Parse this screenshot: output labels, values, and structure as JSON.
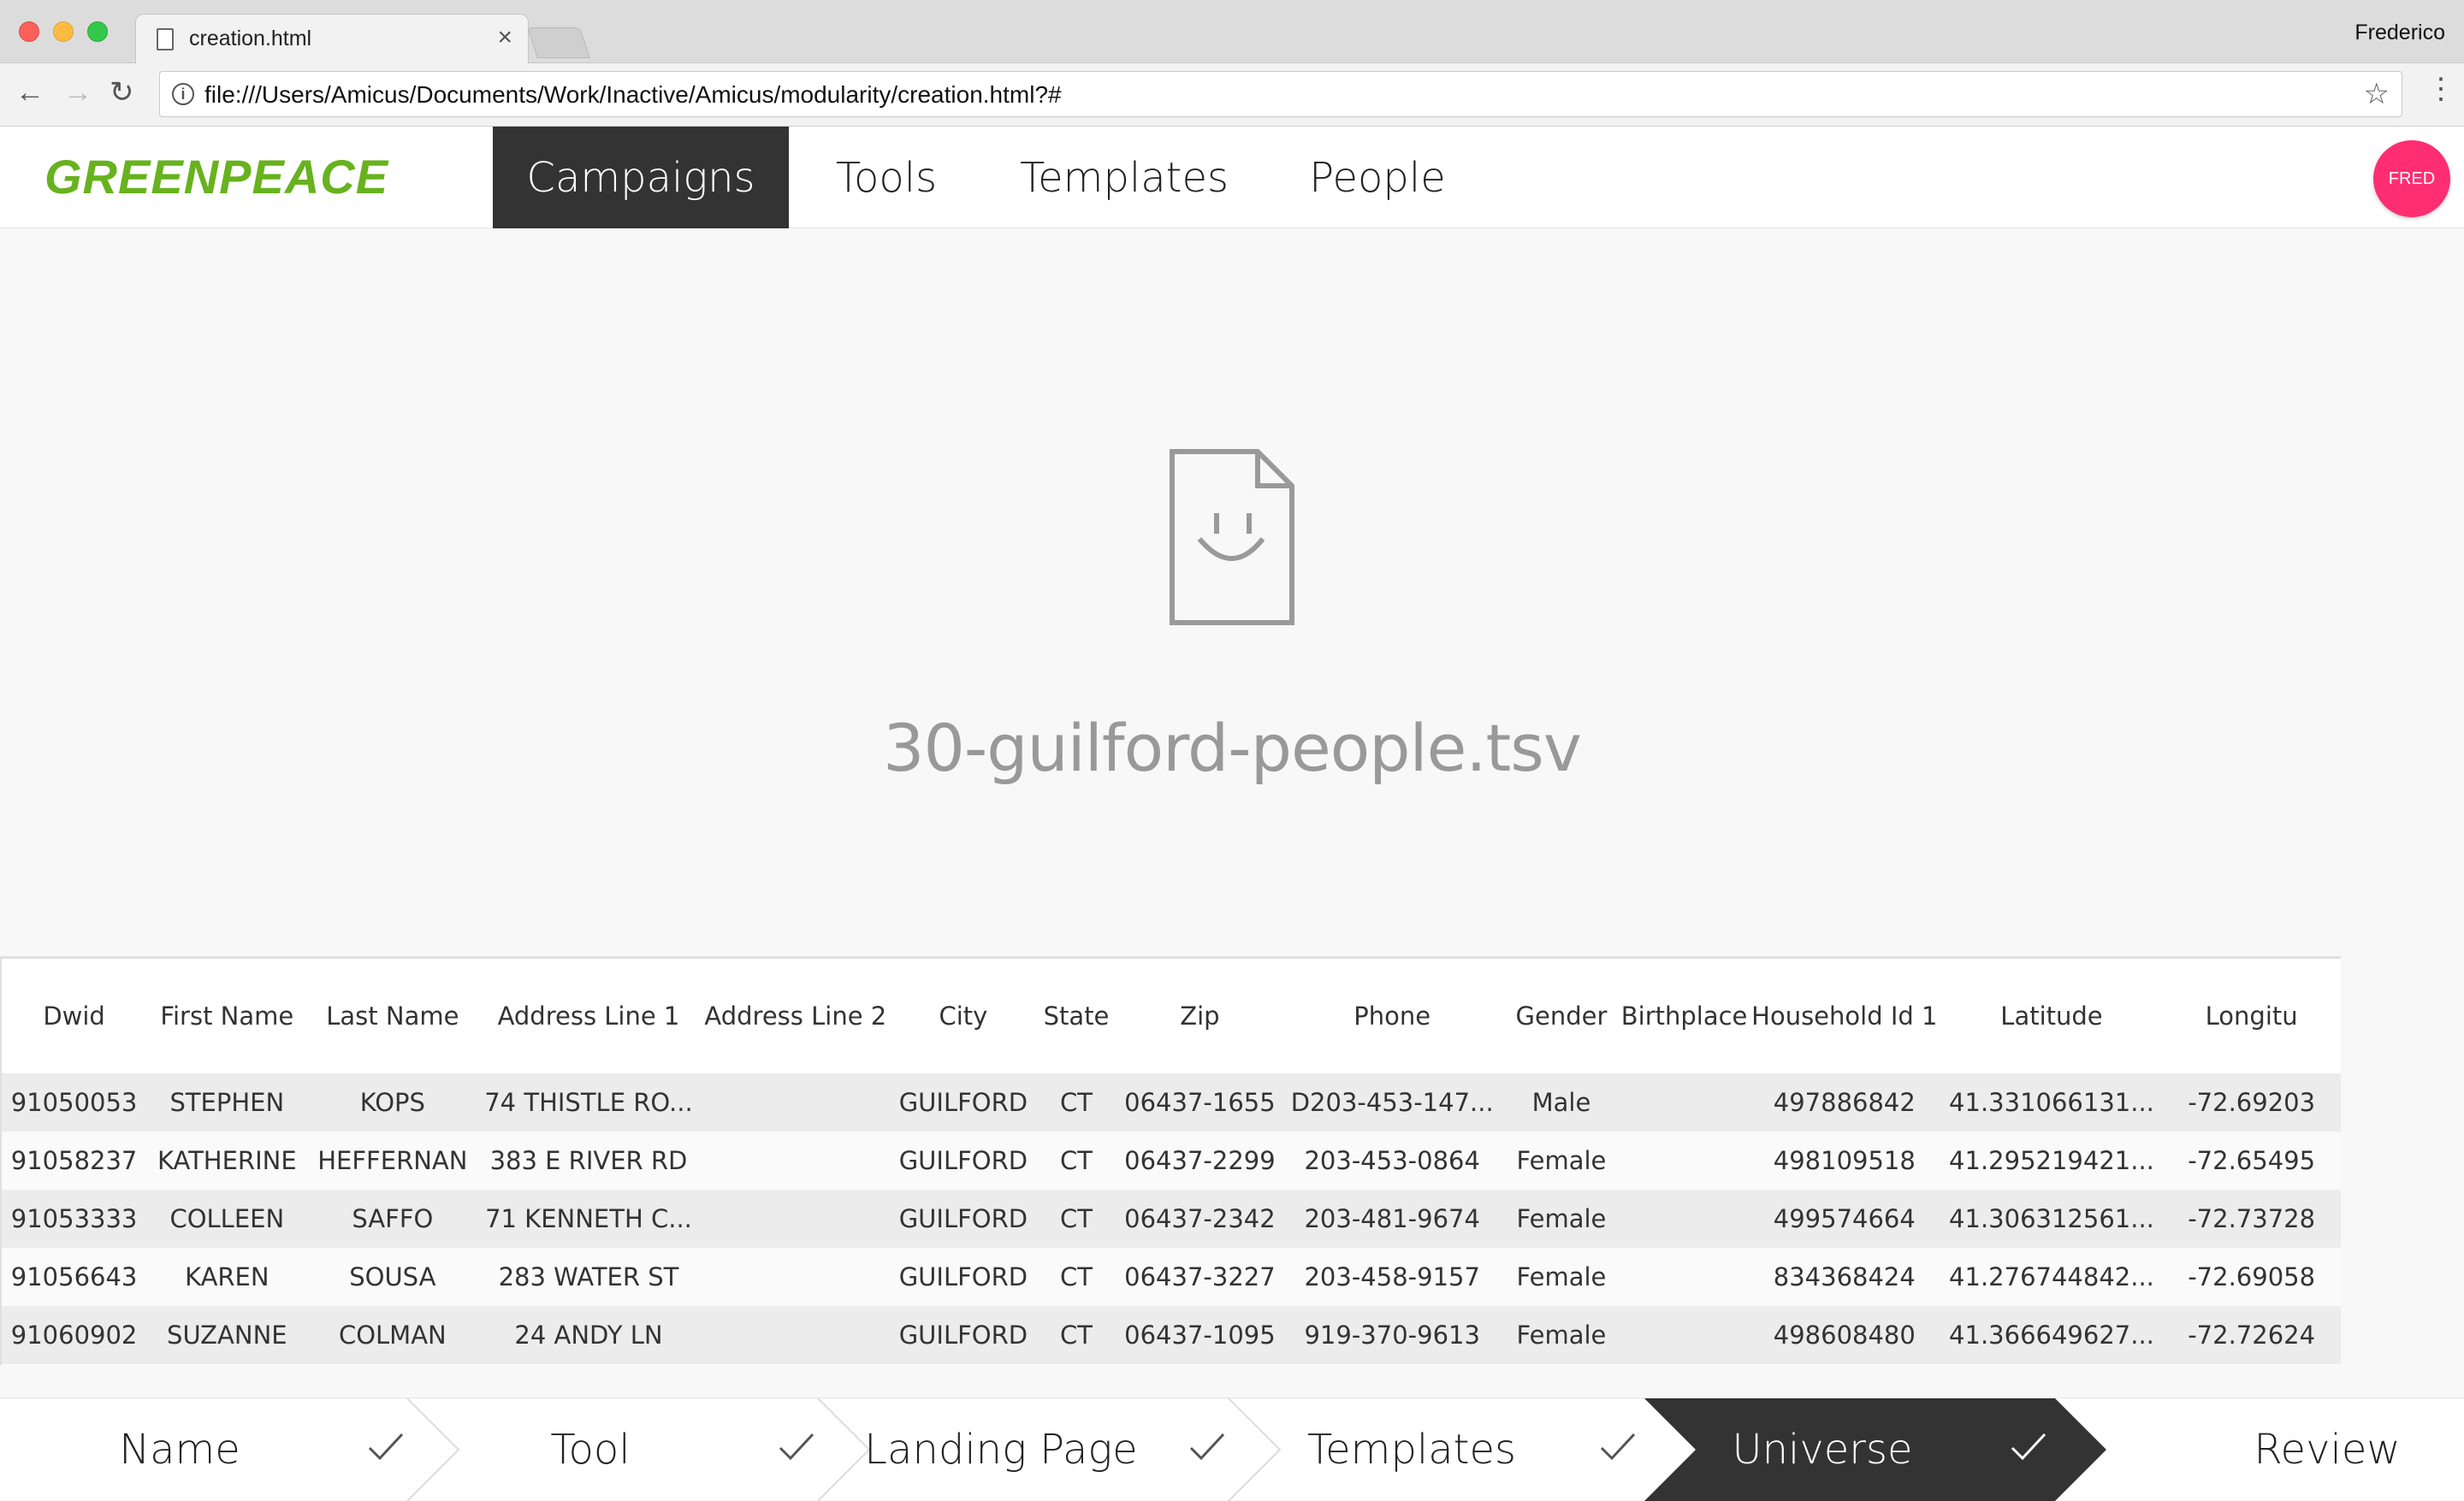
{
  "browser": {
    "tab_title": "creation.html",
    "profile_name": "Frederico",
    "url": "file:///Users/Amicus/Documents/Work/Inactive/Amicus/modularity/creation.html?#"
  },
  "header": {
    "logo_text": "GREENPEACE",
    "logo_color": "#67b21e",
    "nav": [
      {
        "label": "Campaigns",
        "active": true
      },
      {
        "label": "Tools",
        "active": false
      },
      {
        "label": "Templates",
        "active": false
      },
      {
        "label": "People",
        "active": false
      }
    ],
    "avatar_label": "FRED",
    "avatar_color": "#ff2d72"
  },
  "file": {
    "icon": "smiley-file-icon",
    "name": "30-guilford-people.tsv"
  },
  "table": {
    "columns": [
      "Dwid",
      "First Name",
      "Last Name",
      "Address Line 1",
      "Address Line 2",
      "City",
      "State",
      "Zip",
      "Phone",
      "Gender",
      "Birthplace",
      "Household Id 1",
      "Latitude",
      "Longitu"
    ],
    "rows": [
      [
        "91050053",
        "STEPHEN",
        "KOPS",
        "74 THISTLE RO...",
        "",
        "GUILFORD",
        "CT",
        "06437-1655",
        "D203-453-147...",
        "Male",
        "",
        "497886842",
        "41.331066131...",
        "-72.69203"
      ],
      [
        "91058237",
        "KATHERINE",
        "HEFFERNAN",
        "383 E RIVER RD",
        "",
        "GUILFORD",
        "CT",
        "06437-2299",
        "203-453-0864",
        "Female",
        "",
        "498109518",
        "41.295219421...",
        "-72.65495"
      ],
      [
        "91053333",
        "COLLEEN",
        "SAFFO",
        "71 KENNETH C...",
        "",
        "GUILFORD",
        "CT",
        "06437-2342",
        "203-481-9674",
        "Female",
        "",
        "499574664",
        "41.306312561...",
        "-72.73728"
      ],
      [
        "91056643",
        "KAREN",
        "SOUSA",
        "283 WATER ST",
        "",
        "GUILFORD",
        "CT",
        "06437-3227",
        "203-458-9157",
        "Female",
        "",
        "834368424",
        "41.276744842...",
        "-72.69058"
      ],
      [
        "91060902",
        "SUZANNE",
        "COLMAN",
        "24 ANDY LN",
        "",
        "GUILFORD",
        "CT",
        "06437-1095",
        "919-370-9613",
        "Female",
        "",
        "498608480",
        "41.366649627...",
        "-72.72624"
      ]
    ]
  },
  "stepper": {
    "steps": [
      {
        "label": "Name",
        "done": true,
        "active": false
      },
      {
        "label": "Tool",
        "done": true,
        "active": false
      },
      {
        "label": "Landing Page",
        "done": true,
        "active": false
      },
      {
        "label": "Templates",
        "done": true,
        "active": false
      },
      {
        "label": "Universe",
        "done": true,
        "active": true
      },
      {
        "label": "Review",
        "done": false,
        "active": false
      }
    ],
    "active_color": "#333333"
  }
}
